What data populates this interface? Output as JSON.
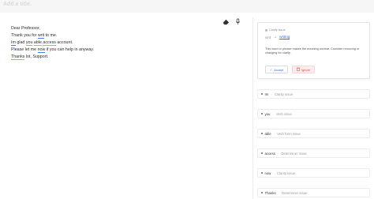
{
  "title_placeholder": "Add a title.",
  "toolbar": {
    "eraser_icon": "eraser-icon",
    "mic_icon": "microphone-icon"
  },
  "editor": {
    "lines": [
      {
        "segments": [
          {
            "text": "Dear Professor,"
          }
        ]
      },
      {
        "segments": [
          {
            "text": "Thank you for "
          },
          {
            "text": "writ",
            "u": "blue"
          },
          {
            "text": " to me."
          }
        ]
      },
      {
        "segments": [
          {
            "text": "Im",
            "u": "blue"
          },
          {
            "text": " glad "
          },
          {
            "text": "you",
            "u": "orange"
          },
          {
            "text": " "
          },
          {
            "text": "able",
            "u": "orange"
          },
          {
            "text": " "
          },
          {
            "text": "access",
            "u": "orange"
          },
          {
            "text": " account."
          }
        ]
      },
      {
        "segments": [
          {
            "text": "Please let me "
          },
          {
            "text": "now",
            "u": "blue"
          },
          {
            "text": " if you can help in anyway."
          }
        ]
      },
      {
        "segments": [
          {
            "text": "Thanks",
            "u": "orange"
          },
          {
            "text": " lot, Support."
          }
        ]
      }
    ]
  },
  "active_issue": {
    "category": "Clarity issue",
    "original": "writ",
    "suggestion": "writing",
    "description": "This word or phrase makes the meaning unclear. Consider removing or changing for clarity.",
    "accept_label": "Accept",
    "ignore_label": "Ignore"
  },
  "issues": [
    {
      "word": "Im",
      "type": "Clarity issue"
    },
    {
      "word": "you",
      "type": "Verb issue"
    },
    {
      "word": "able",
      "type": "Verb form issue"
    },
    {
      "word": "access",
      "type": "Determiner issue"
    },
    {
      "word": "now",
      "type": "Clarity issue"
    },
    {
      "word": "Thanks",
      "type": "Determiner issue"
    }
  ],
  "colors": {
    "accent": "#2f66d8",
    "underline_blue": "#4a7fe6",
    "underline_orange": "#e8a33a",
    "ignore_red": "#dd4444"
  }
}
